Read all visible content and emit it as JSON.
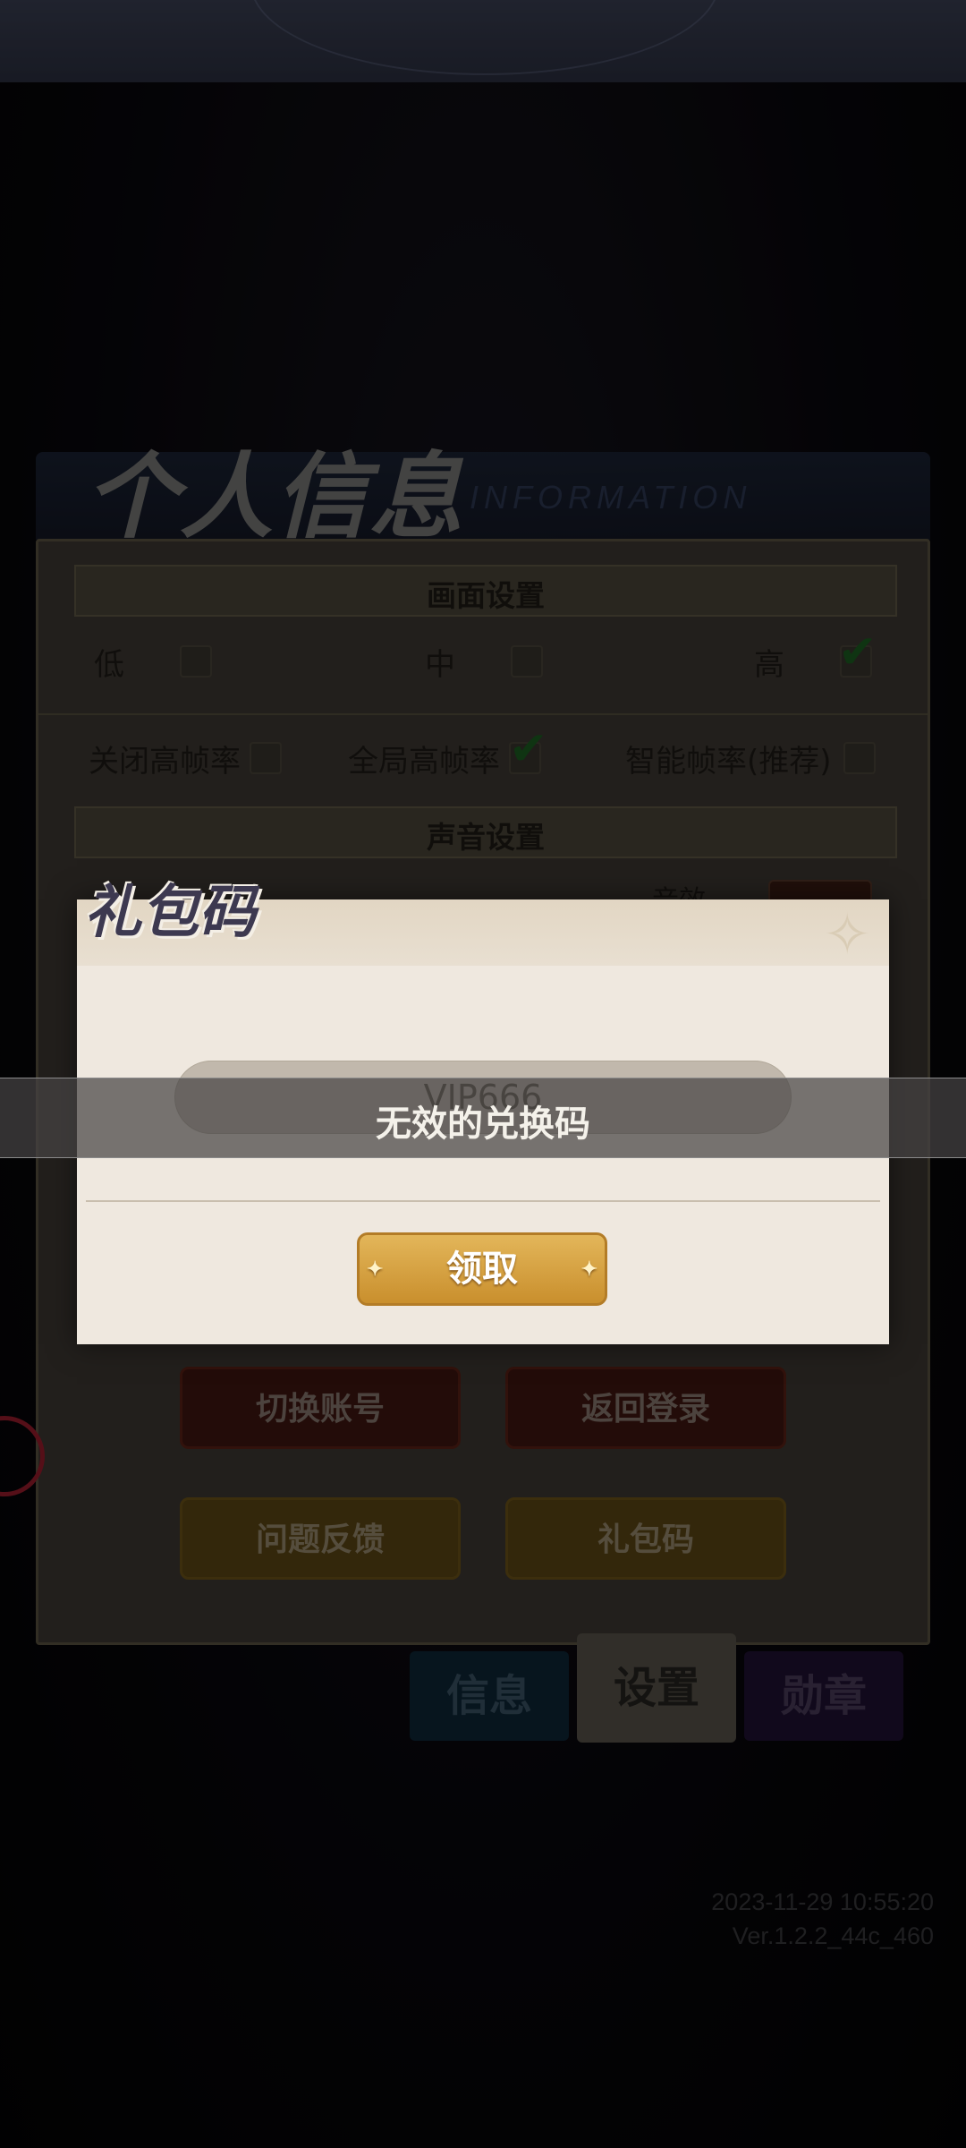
{
  "panel": {
    "title": "个人信息",
    "title_en": "INFORMATION",
    "graphics": {
      "heading": "画面设置",
      "quality": [
        {
          "label": "低",
          "checked": false
        },
        {
          "label": "中",
          "checked": false
        },
        {
          "label": "高",
          "checked": true
        }
      ],
      "framerate": [
        {
          "label": "关闭高帧率",
          "checked": false
        },
        {
          "label": "全局高帧率",
          "checked": true
        },
        {
          "label": "智能帧率(推荐)",
          "checked": false
        }
      ]
    },
    "sound": {
      "heading": "声音设置",
      "sfx_label": "音效"
    },
    "buttons": {
      "switch_account": "切换账号",
      "back_to_login": "返回登录",
      "feedback": "问题反馈",
      "gift_code": "礼包码"
    },
    "tabs": [
      "信息",
      "设置",
      "勋章"
    ],
    "active_tab": "设置",
    "timestamp": "2023-11-29 10:55:20",
    "version": "Ver.1.2.2_44c_460"
  },
  "dialog": {
    "title": "礼包码",
    "code_value": "VIP666",
    "claim_label": "领取"
  },
  "toast": {
    "message": "无效的兑换码"
  },
  "colors": {
    "claim_button": "#d9a445",
    "dialog_bg": "#efe8df",
    "check_green": "#1c5f22"
  }
}
